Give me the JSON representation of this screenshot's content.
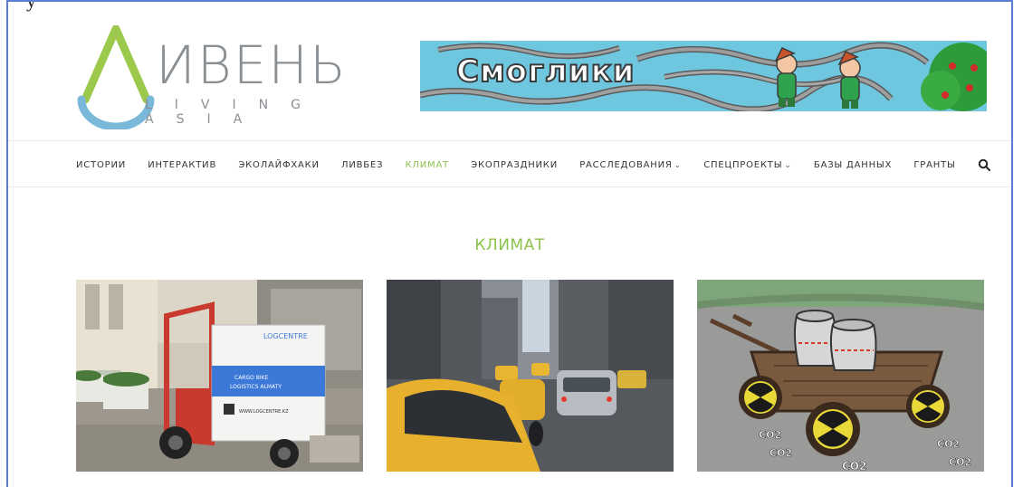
{
  "site": {
    "logo_word": "ИВЕНЬ",
    "logo_tagline": "LIVING ASIA",
    "top_strip_text": "y"
  },
  "banner": {
    "title": "Смоглики"
  },
  "nav": {
    "items": [
      {
        "label": "ИСТОРИИ",
        "active": false,
        "dropdown": false
      },
      {
        "label": "ИНТЕРАКТИВ",
        "active": false,
        "dropdown": false
      },
      {
        "label": "ЭКОЛАЙФХАКИ",
        "active": false,
        "dropdown": false
      },
      {
        "label": "ЛИВБЕЗ",
        "active": false,
        "dropdown": false
      },
      {
        "label": "КЛИМАТ",
        "active": true,
        "dropdown": false
      },
      {
        "label": "ЭКОПРАЗДНИКИ",
        "active": false,
        "dropdown": false
      },
      {
        "label": "РАССЛЕДОВАНИЯ",
        "active": false,
        "dropdown": true
      },
      {
        "label": "СПЕЦПРОЕКТЫ",
        "active": false,
        "dropdown": true
      },
      {
        "label": "БАЗЫ ДАННЫХ",
        "active": false,
        "dropdown": false
      },
      {
        "label": "ГРАНТЫ",
        "active": false,
        "dropdown": false
      }
    ],
    "chevron_glyph": "⌄",
    "search_icon": "search-icon"
  },
  "section": {
    "title": "КЛИМАТ"
  },
  "cards": [
    {
      "image": "cargo-bike-photo",
      "box_brand": "LOGCENTRE",
      "box_line1": "CARGO BIKE",
      "box_line2": "LOGISTICS ALMATY",
      "box_url": "WWW.LOGCENTRE.KZ"
    },
    {
      "image": "city-taxi-traffic-photo"
    },
    {
      "image": "cart-cooling-towers-illustration",
      "labels": [
        "CO2",
        "CO2",
        "CO2",
        "CO2",
        "CO2"
      ]
    }
  ],
  "colors": {
    "accent": "#8cc24a",
    "logo_gray": "#8a8f94",
    "logo_blue": "#79b8d9",
    "logo_green": "#9cc94c"
  }
}
